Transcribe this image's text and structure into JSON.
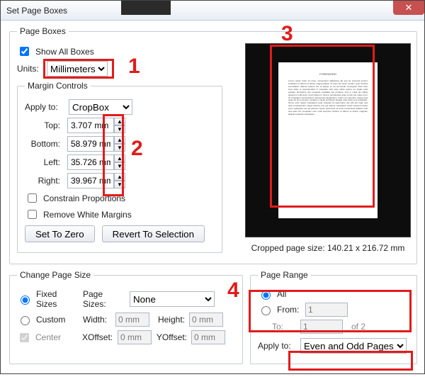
{
  "window": {
    "title": "Set Page Boxes",
    "close": "✕"
  },
  "pageBoxes": {
    "legend": "Page Boxes",
    "showAll": "Show All Boxes",
    "unitsLabel": "Units:",
    "unitsValue": "Millimeters",
    "marginControls": {
      "legend": "Margin Controls",
      "applyToLabel": "Apply to:",
      "applyToValue": "CropBox",
      "top": {
        "label": "Top:",
        "value": "3.707 mm"
      },
      "bottom": {
        "label": "Bottom:",
        "value": "58.979 mm"
      },
      "left": {
        "label": "Left:",
        "value": "35.726 mm"
      },
      "right": {
        "label": "Right:",
        "value": "39.967 mm"
      },
      "constrain": "Constrain Proportions",
      "removeWhite": "Remove White Margins",
      "setZero": "Set To Zero",
      "revert": "Revert To Selection"
    }
  },
  "preview": {
    "caption": "Cropped page size: 140.21 x 216.72 mm",
    "docHeader": "FOREWORD"
  },
  "changePageSize": {
    "legend": "Change Page Size",
    "fixed": "Fixed Sizes",
    "pageSizesLabel": "Page Sizes:",
    "pageSizesValue": "None",
    "custom": "Custom",
    "widthLabel": "Width:",
    "widthValue": "0 mm",
    "heightLabel": "Height:",
    "heightValue": "0 mm",
    "center": "Center",
    "xoffLabel": "XOffset:",
    "xoffValue": "0 mm",
    "yoffLabel": "YOffset:",
    "yoffValue": "0 mm"
  },
  "pageRange": {
    "legend": "Page Range",
    "all": "All",
    "fromLabel": "From:",
    "fromValue": "1",
    "toLabel": "To:",
    "toValue": "1",
    "ofText": "of 2",
    "applyToLabel": "Apply to:",
    "applyToValue": "Even and Odd Pages"
  },
  "annotations": {
    "n1": "1",
    "n2": "2",
    "n3": "3",
    "n4": "4"
  }
}
